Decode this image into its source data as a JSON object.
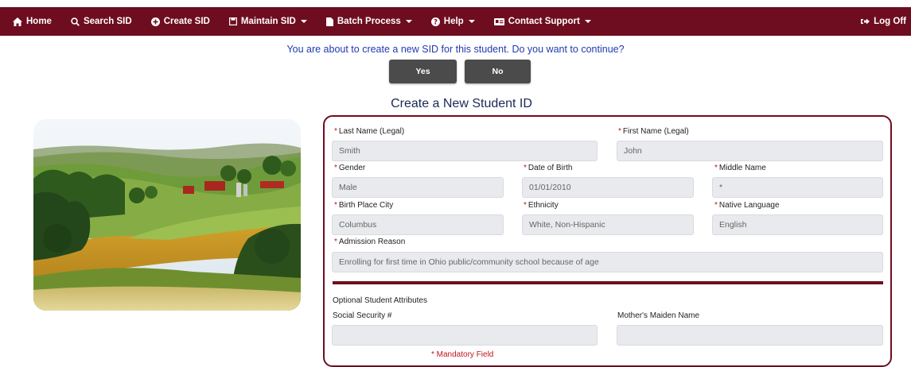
{
  "nav": {
    "items": [
      {
        "label": "Home",
        "icon": "home-icon",
        "dropdown": false
      },
      {
        "label": "Search SID",
        "icon": "search-icon",
        "dropdown": false
      },
      {
        "label": "Create SID",
        "icon": "plus-circle-icon",
        "dropdown": false
      },
      {
        "label": "Maintain SID",
        "icon": "save-icon",
        "dropdown": true
      },
      {
        "label": "Batch Process",
        "icon": "file-icon",
        "dropdown": true
      },
      {
        "label": "Help",
        "icon": "question-circle-icon",
        "dropdown": true
      },
      {
        "label": "Contact Support",
        "icon": "id-card-icon",
        "dropdown": true
      }
    ],
    "logoff": {
      "label": "Log Off",
      "icon": "sign-out-icon"
    }
  },
  "confirm": {
    "message": "You are about to create a new SID for this student. Do you want to continue?",
    "yes_label": "Yes",
    "no_label": "No"
  },
  "page_title": "Create a New Student ID",
  "form": {
    "last_name": {
      "label": "Last Name (Legal)",
      "value": "Smith",
      "required": true
    },
    "first_name": {
      "label": "First Name (Legal)",
      "value": "John",
      "required": true
    },
    "gender": {
      "label": "Gender",
      "value": "Male",
      "required": true
    },
    "dob": {
      "label": "Date of Birth",
      "value": "01/01/2010",
      "required": true
    },
    "middle_name": {
      "label": "Middle Name",
      "value": "*",
      "required": true
    },
    "birth_city": {
      "label": "Birth Place City",
      "value": "Columbus",
      "required": true
    },
    "ethnicity": {
      "label": "Ethnicity",
      "value": "White, Non-Hispanic",
      "required": true
    },
    "native_language": {
      "label": "Native Language",
      "value": "English",
      "required": true
    },
    "admission_reason": {
      "label": "Admission Reason",
      "value": "Enrolling for first time in Ohio public/community school because of age",
      "required": true
    },
    "optional_heading": "Optional Student Attributes",
    "ssn": {
      "label": "Social Security #",
      "value": ""
    },
    "maiden_name": {
      "label": "Mother's Maiden Name",
      "value": ""
    },
    "mandatory_note": "* Mandatory Field"
  },
  "colors": {
    "brand": "#6e0d20",
    "link": "#1f3bb3",
    "required": "#c0141b",
    "button": "#4b4b4b"
  }
}
